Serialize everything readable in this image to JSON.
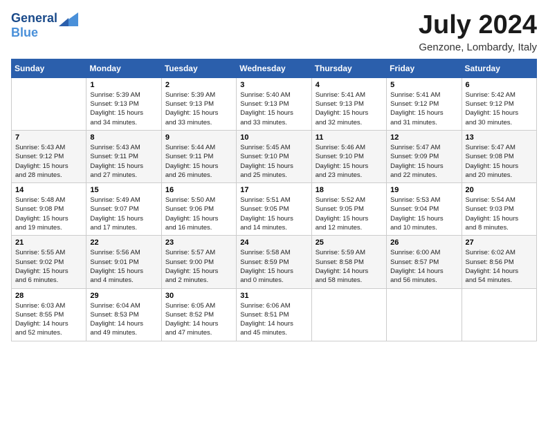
{
  "header": {
    "logo_line1": "General",
    "logo_line2": "Blue",
    "month_title": "July 2024",
    "location": "Genzone, Lombardy, Italy"
  },
  "weekdays": [
    "Sunday",
    "Monday",
    "Tuesday",
    "Wednesday",
    "Thursday",
    "Friday",
    "Saturday"
  ],
  "weeks": [
    [
      {
        "day": "",
        "sunrise": "",
        "sunset": "",
        "daylight": ""
      },
      {
        "day": "1",
        "sunrise": "Sunrise: 5:39 AM",
        "sunset": "Sunset: 9:13 PM",
        "daylight": "Daylight: 15 hours and 34 minutes."
      },
      {
        "day": "2",
        "sunrise": "Sunrise: 5:39 AM",
        "sunset": "Sunset: 9:13 PM",
        "daylight": "Daylight: 15 hours and 33 minutes."
      },
      {
        "day": "3",
        "sunrise": "Sunrise: 5:40 AM",
        "sunset": "Sunset: 9:13 PM",
        "daylight": "Daylight: 15 hours and 33 minutes."
      },
      {
        "day": "4",
        "sunrise": "Sunrise: 5:41 AM",
        "sunset": "Sunset: 9:13 PM",
        "daylight": "Daylight: 15 hours and 32 minutes."
      },
      {
        "day": "5",
        "sunrise": "Sunrise: 5:41 AM",
        "sunset": "Sunset: 9:12 PM",
        "daylight": "Daylight: 15 hours and 31 minutes."
      },
      {
        "day": "6",
        "sunrise": "Sunrise: 5:42 AM",
        "sunset": "Sunset: 9:12 PM",
        "daylight": "Daylight: 15 hours and 30 minutes."
      }
    ],
    [
      {
        "day": "7",
        "sunrise": "Sunrise: 5:43 AM",
        "sunset": "Sunset: 9:12 PM",
        "daylight": "Daylight: 15 hours and 28 minutes."
      },
      {
        "day": "8",
        "sunrise": "Sunrise: 5:43 AM",
        "sunset": "Sunset: 9:11 PM",
        "daylight": "Daylight: 15 hours and 27 minutes."
      },
      {
        "day": "9",
        "sunrise": "Sunrise: 5:44 AM",
        "sunset": "Sunset: 9:11 PM",
        "daylight": "Daylight: 15 hours and 26 minutes."
      },
      {
        "day": "10",
        "sunrise": "Sunrise: 5:45 AM",
        "sunset": "Sunset: 9:10 PM",
        "daylight": "Daylight: 15 hours and 25 minutes."
      },
      {
        "day": "11",
        "sunrise": "Sunrise: 5:46 AM",
        "sunset": "Sunset: 9:10 PM",
        "daylight": "Daylight: 15 hours and 23 minutes."
      },
      {
        "day": "12",
        "sunrise": "Sunrise: 5:47 AM",
        "sunset": "Sunset: 9:09 PM",
        "daylight": "Daylight: 15 hours and 22 minutes."
      },
      {
        "day": "13",
        "sunrise": "Sunrise: 5:47 AM",
        "sunset": "Sunset: 9:08 PM",
        "daylight": "Daylight: 15 hours and 20 minutes."
      }
    ],
    [
      {
        "day": "14",
        "sunrise": "Sunrise: 5:48 AM",
        "sunset": "Sunset: 9:08 PM",
        "daylight": "Daylight: 15 hours and 19 minutes."
      },
      {
        "day": "15",
        "sunrise": "Sunrise: 5:49 AM",
        "sunset": "Sunset: 9:07 PM",
        "daylight": "Daylight: 15 hours and 17 minutes."
      },
      {
        "day": "16",
        "sunrise": "Sunrise: 5:50 AM",
        "sunset": "Sunset: 9:06 PM",
        "daylight": "Daylight: 15 hours and 16 minutes."
      },
      {
        "day": "17",
        "sunrise": "Sunrise: 5:51 AM",
        "sunset": "Sunset: 9:05 PM",
        "daylight": "Daylight: 15 hours and 14 minutes."
      },
      {
        "day": "18",
        "sunrise": "Sunrise: 5:52 AM",
        "sunset": "Sunset: 9:05 PM",
        "daylight": "Daylight: 15 hours and 12 minutes."
      },
      {
        "day": "19",
        "sunrise": "Sunrise: 5:53 AM",
        "sunset": "Sunset: 9:04 PM",
        "daylight": "Daylight: 15 hours and 10 minutes."
      },
      {
        "day": "20",
        "sunrise": "Sunrise: 5:54 AM",
        "sunset": "Sunset: 9:03 PM",
        "daylight": "Daylight: 15 hours and 8 minutes."
      }
    ],
    [
      {
        "day": "21",
        "sunrise": "Sunrise: 5:55 AM",
        "sunset": "Sunset: 9:02 PM",
        "daylight": "Daylight: 15 hours and 6 minutes."
      },
      {
        "day": "22",
        "sunrise": "Sunrise: 5:56 AM",
        "sunset": "Sunset: 9:01 PM",
        "daylight": "Daylight: 15 hours and 4 minutes."
      },
      {
        "day": "23",
        "sunrise": "Sunrise: 5:57 AM",
        "sunset": "Sunset: 9:00 PM",
        "daylight": "Daylight: 15 hours and 2 minutes."
      },
      {
        "day": "24",
        "sunrise": "Sunrise: 5:58 AM",
        "sunset": "Sunset: 8:59 PM",
        "daylight": "Daylight: 15 hours and 0 minutes."
      },
      {
        "day": "25",
        "sunrise": "Sunrise: 5:59 AM",
        "sunset": "Sunset: 8:58 PM",
        "daylight": "Daylight: 14 hours and 58 minutes."
      },
      {
        "day": "26",
        "sunrise": "Sunrise: 6:00 AM",
        "sunset": "Sunset: 8:57 PM",
        "daylight": "Daylight: 14 hours and 56 minutes."
      },
      {
        "day": "27",
        "sunrise": "Sunrise: 6:02 AM",
        "sunset": "Sunset: 8:56 PM",
        "daylight": "Daylight: 14 hours and 54 minutes."
      }
    ],
    [
      {
        "day": "28",
        "sunrise": "Sunrise: 6:03 AM",
        "sunset": "Sunset: 8:55 PM",
        "daylight": "Daylight: 14 hours and 52 minutes."
      },
      {
        "day": "29",
        "sunrise": "Sunrise: 6:04 AM",
        "sunset": "Sunset: 8:53 PM",
        "daylight": "Daylight: 14 hours and 49 minutes."
      },
      {
        "day": "30",
        "sunrise": "Sunrise: 6:05 AM",
        "sunset": "Sunset: 8:52 PM",
        "daylight": "Daylight: 14 hours and 47 minutes."
      },
      {
        "day": "31",
        "sunrise": "Sunrise: 6:06 AM",
        "sunset": "Sunset: 8:51 PM",
        "daylight": "Daylight: 14 hours and 45 minutes."
      },
      {
        "day": "",
        "sunrise": "",
        "sunset": "",
        "daylight": ""
      },
      {
        "day": "",
        "sunrise": "",
        "sunset": "",
        "daylight": ""
      },
      {
        "day": "",
        "sunrise": "",
        "sunset": "",
        "daylight": ""
      }
    ]
  ]
}
